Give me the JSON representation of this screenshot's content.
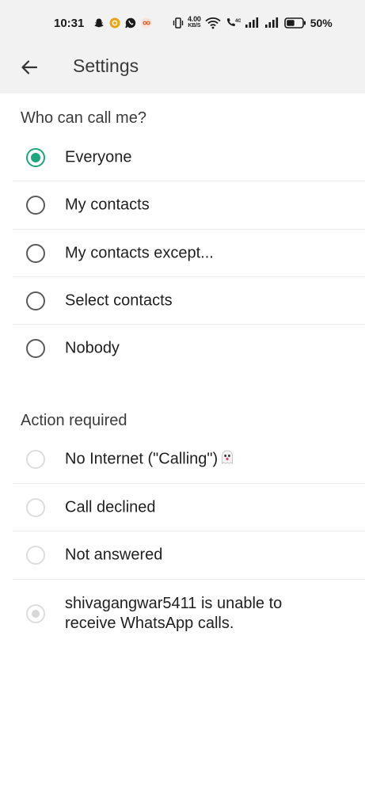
{
  "status_bar": {
    "time": "10:31",
    "net_speed_value": "4.00",
    "net_speed_unit": "KB/S",
    "battery": "50%"
  },
  "app_bar": {
    "title": "Settings"
  },
  "who_can_call": {
    "header": "Who can call me?",
    "options": [
      {
        "label": "Everyone",
        "selected": true
      },
      {
        "label": "My contacts",
        "selected": false
      },
      {
        "label": "My contacts except...",
        "selected": false
      },
      {
        "label": "Select contacts",
        "selected": false
      },
      {
        "label": "Nobody",
        "selected": false
      }
    ]
  },
  "action_required": {
    "header": "Action required",
    "options": [
      {
        "label": "No Internet (\"Calling\")"
      },
      {
        "label": "Call declined"
      },
      {
        "label": "Not answered"
      },
      {
        "label": "shivagangwar5411 is unable to receive WhatsApp calls."
      }
    ]
  },
  "colors": {
    "accent": "#1da67d",
    "topbar_bg": "#f2f2f2"
  }
}
